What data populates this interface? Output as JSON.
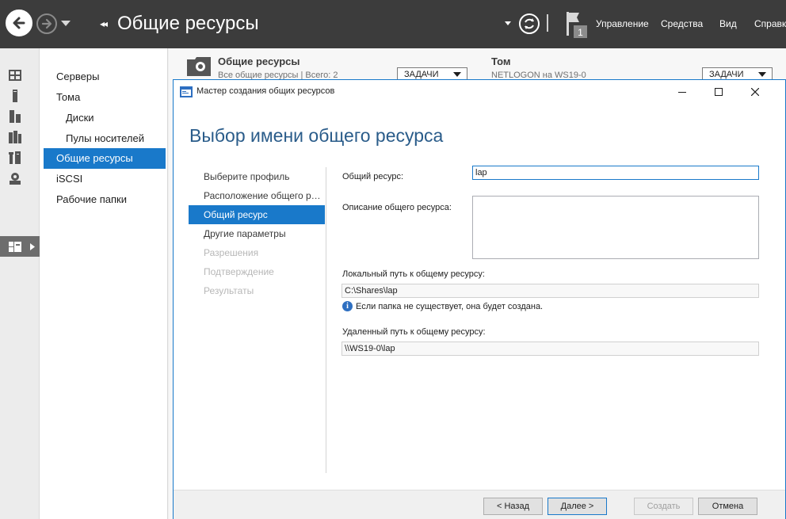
{
  "topbar": {
    "title": "Общие ресурсы",
    "title_chevrons": "◂◂",
    "notifications_count": "1",
    "menu": [
      "Управление",
      "Средства",
      "Вид",
      "Справка"
    ]
  },
  "icon_strip": {
    "icons": [
      "dashboard-icon",
      "local-server-icon",
      "all-servers-icon",
      "file-services-icon",
      "tools-icon",
      "storage-icon",
      "shares-icon"
    ]
  },
  "navtree": {
    "items": [
      {
        "label": "Серверы"
      },
      {
        "label": "Тома"
      },
      {
        "label": "Диски"
      },
      {
        "label": "Пулы носителей"
      },
      {
        "label": "Общие ресурсы"
      },
      {
        "label": "iSCSI"
      },
      {
        "label": "Рабочие папки"
      }
    ]
  },
  "background": {
    "shares_tile": {
      "title": "Общие ресурсы",
      "subtitle": "Все общие ресурсы | Всего: 2",
      "tasks": "ЗАДАЧИ"
    },
    "volume_tile": {
      "title": "Том",
      "subtitle": "NETLOGON на WS19-0",
      "tasks": "ЗАДАЧИ"
    }
  },
  "dialog": {
    "title": "Мастер создания общих ресурсов",
    "heading": "Выбор имени общего ресурса",
    "steps": [
      {
        "label": "Выберите профиль"
      },
      {
        "label": "Расположение общего ресурса"
      },
      {
        "label": "Общий ресурс"
      },
      {
        "label": "Другие параметры"
      },
      {
        "label": "Разрешения"
      },
      {
        "label": "Подтверждение"
      },
      {
        "label": "Результаты"
      }
    ],
    "form": {
      "share_name_label": "Общий ресурс:",
      "share_name_value": "lap",
      "description_label": "Описание общего ресурса:",
      "description_value": "",
      "local_path_label": "Локальный путь к общему ресурсу:",
      "local_path_value": "C:\\Shares\\lap",
      "info_text": "Если папка не существует, она будет создана.",
      "remote_path_label": "Удаленный путь к общему ресурсу:",
      "remote_path_value": "\\\\WS19-0\\lap"
    },
    "buttons": {
      "back": "< Назад",
      "next": "Далее >",
      "create": "Создать",
      "cancel": "Отмена"
    }
  },
  "colors": {
    "topbar_bg": "#3c3c3c",
    "accent": "#1979ca",
    "heading": "#2a5c8a"
  }
}
